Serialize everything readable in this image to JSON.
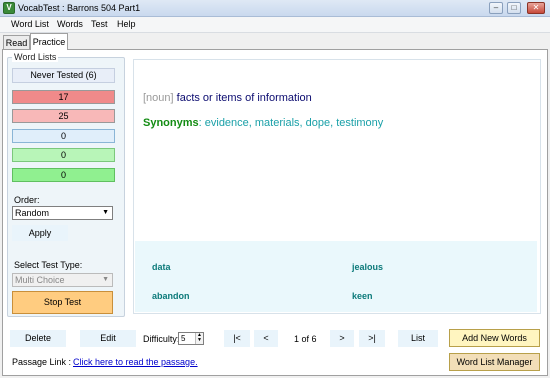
{
  "window": {
    "title": "VocabTest : Barrons 504 Part1",
    "icon_letter": "V",
    "minimize": "–",
    "maximize": "□",
    "close": "✕"
  },
  "menu": [
    "Word List",
    "Words",
    "Test",
    "Help"
  ],
  "tabs": [
    {
      "label": "Read",
      "active": false
    },
    {
      "label": "Practice",
      "active": true
    }
  ],
  "word_lists": {
    "legend": "Word Lists",
    "items": [
      {
        "label": "Never Tested (6)",
        "color": "#e8eef8"
      },
      {
        "label": "17",
        "color": "#f08a8a"
      },
      {
        "label": "25",
        "color": "#f8b8b8"
      },
      {
        "label": "0",
        "color": "#e0eefa"
      },
      {
        "label": "0",
        "color": "#b8f5b8"
      },
      {
        "label": "0",
        "color": "#90f090"
      }
    ]
  },
  "order": {
    "label": "Order:",
    "value": "Random",
    "apply": "Apply"
  },
  "test_type": {
    "label": "Select Test Type:",
    "value": "Multi Choice"
  },
  "stop_test": "Stop Test",
  "question": {
    "part_of_speech": "[noun]",
    "definition": " facts or items of information",
    "synonyms_label": "Synonyms",
    "synonyms": ": evidence, materials, dope, testimony"
  },
  "choices": [
    "data",
    "jealous",
    "abandon",
    "keen"
  ],
  "toolbar": {
    "delete": "Delete",
    "edit": "Edit",
    "difficulty_label": "Difficulty:",
    "difficulty_value": "5",
    "first": "|<",
    "prev": "<",
    "counter": "1 of 6",
    "next": ">",
    "last": ">|",
    "list": "List",
    "add_new_words": "Add New Words",
    "word_list_manager": "Word List Manager"
  },
  "passage": {
    "label": "Passage Link :",
    "link": "Click here to read the passage."
  }
}
